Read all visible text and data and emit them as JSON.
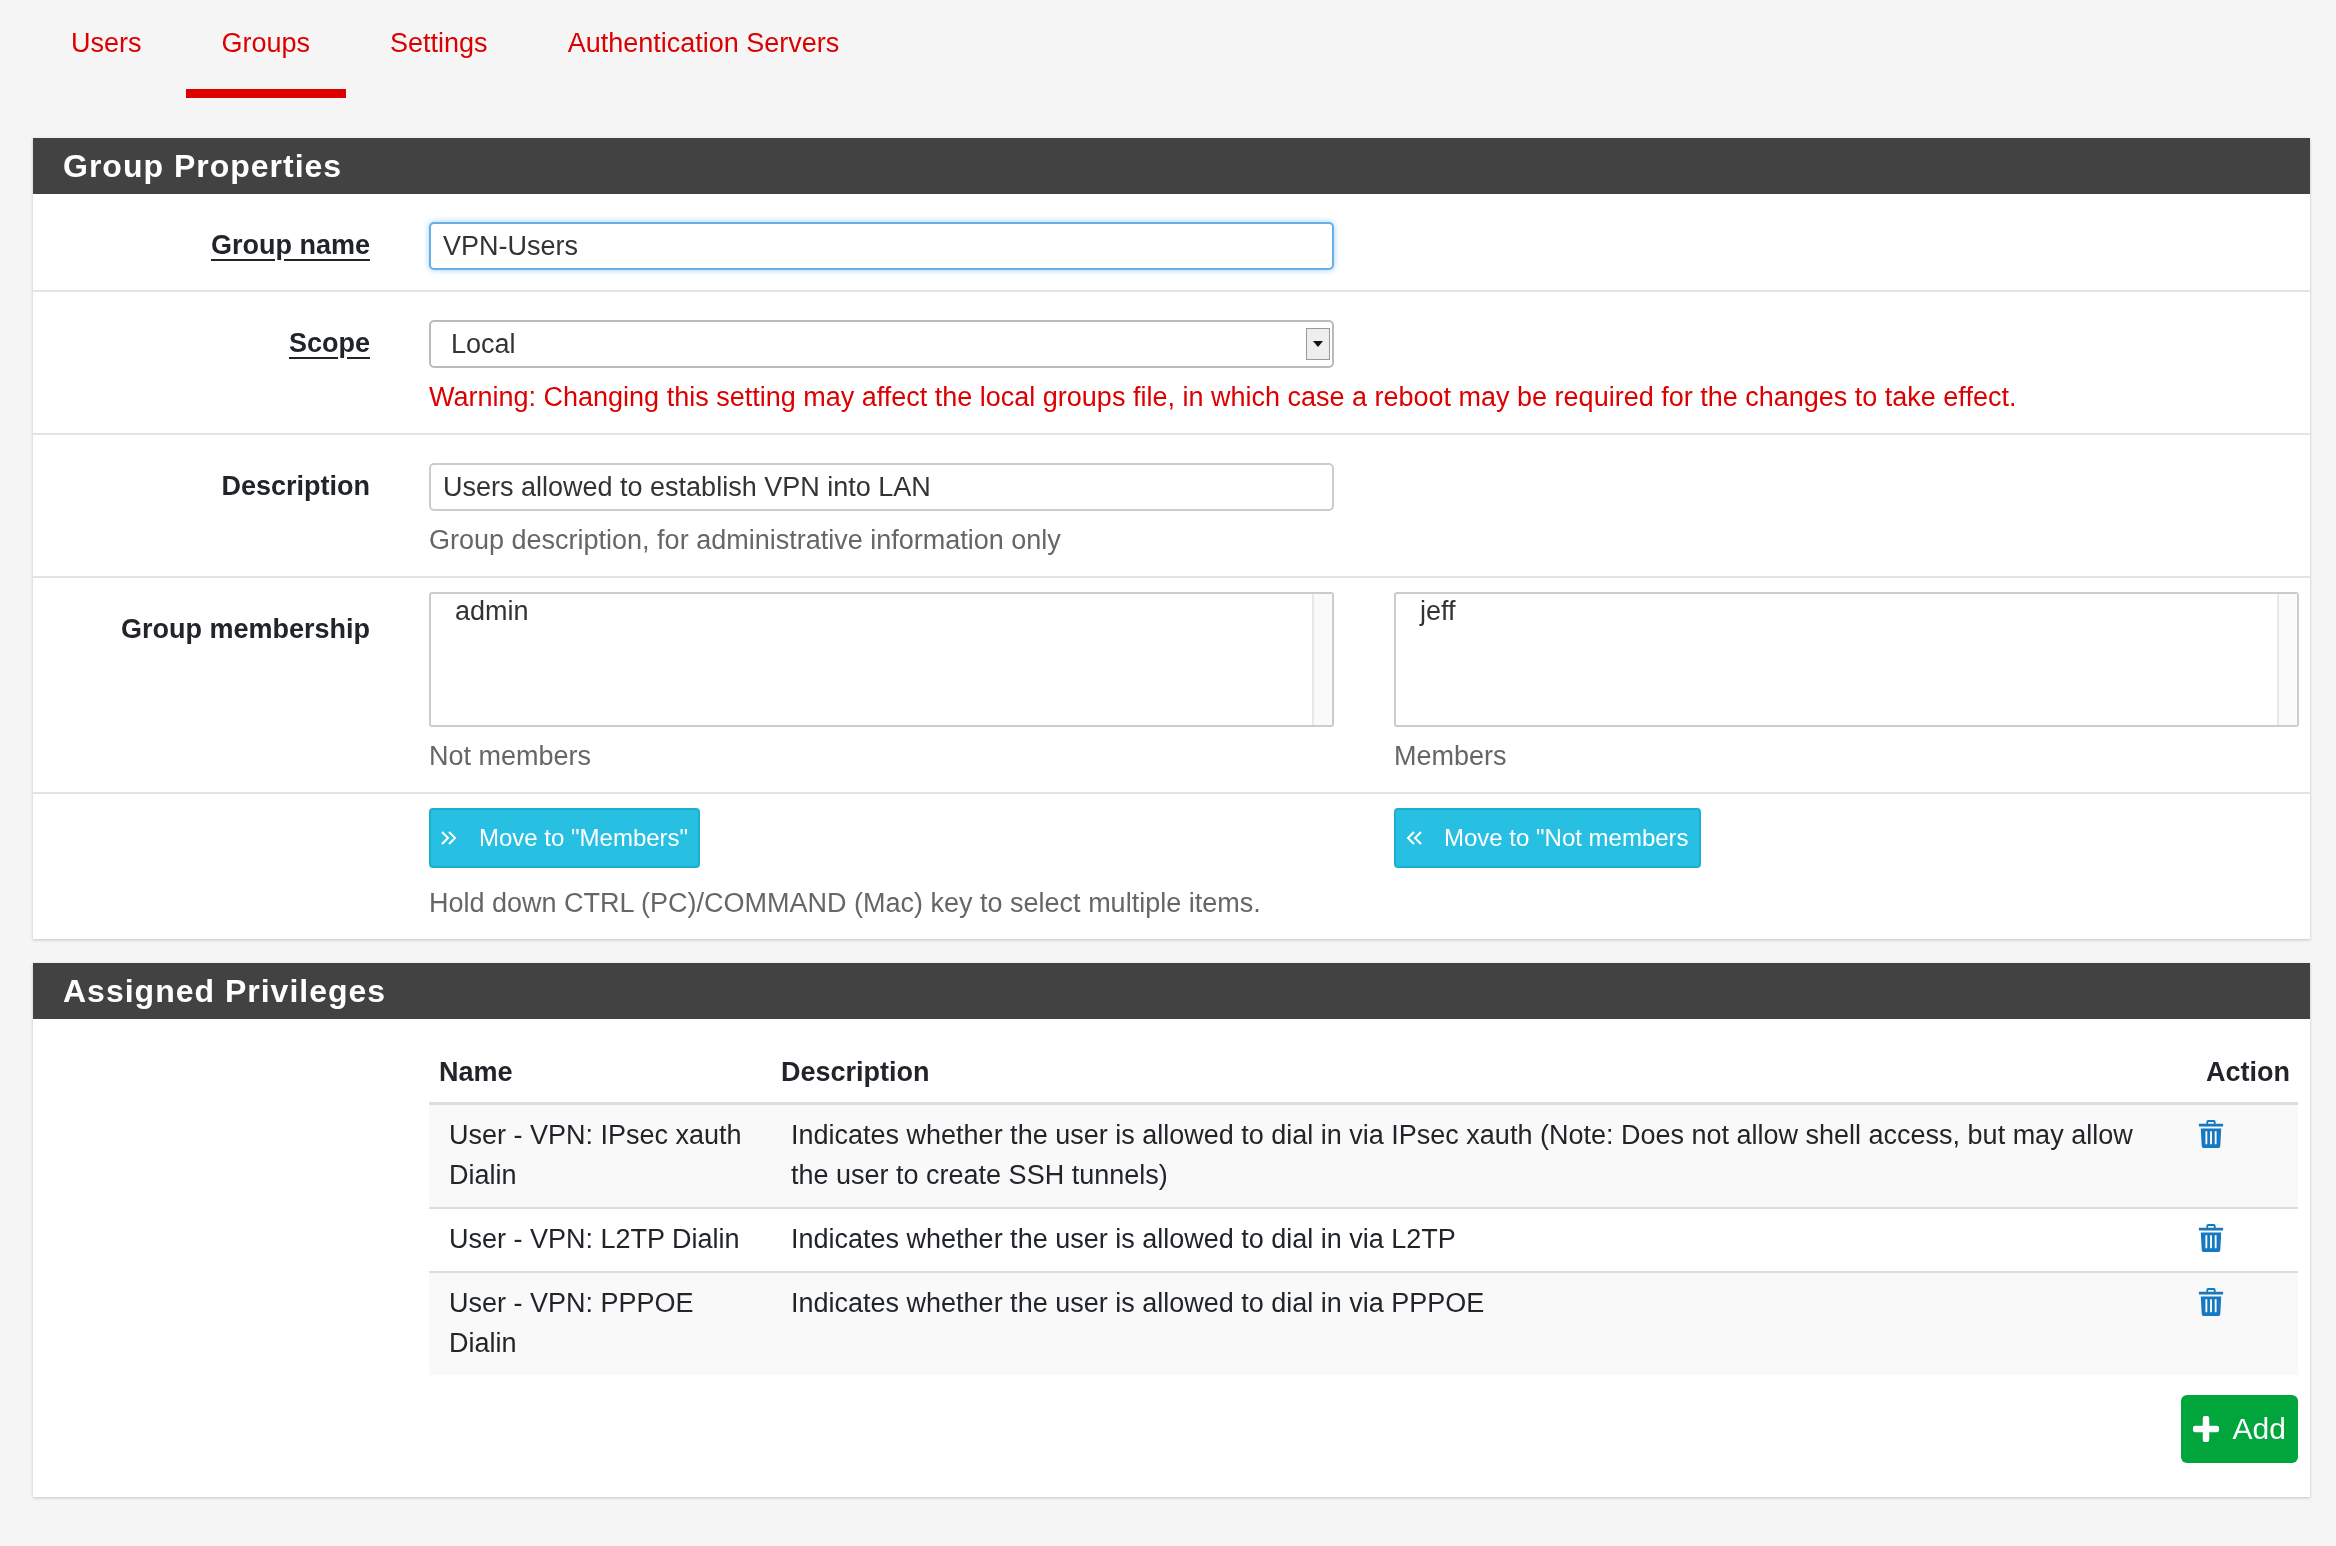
{
  "tabs": [
    {
      "label": "Users",
      "selected": false
    },
    {
      "label": "Groups",
      "selected": true
    },
    {
      "label": "Settings",
      "selected": false
    },
    {
      "label": "Authentication Servers",
      "selected": false
    }
  ],
  "group_properties": {
    "title": "Group Properties",
    "group_name": {
      "label": "Group name",
      "required": true,
      "value": "VPN-Users"
    },
    "scope": {
      "label": "Scope",
      "required": true,
      "value": "Local",
      "warning": "Warning: Changing this setting may affect the local groups file, in which case a reboot may be required for the changes to take effect."
    },
    "description": {
      "label": "Description",
      "required": false,
      "value": "Users allowed to establish VPN into LAN",
      "help": "Group description, for administrative information only"
    },
    "group_membership": {
      "label": "Group membership",
      "required": false,
      "lists": [
        {
          "items": [
            "admin"
          ],
          "caption": "Not members"
        },
        {
          "items": [
            "jeff"
          ],
          "caption": "Members"
        }
      ],
      "buttons": [
        {
          "kind": "forward",
          "label": "Move to \"Members\""
        },
        {
          "kind": "back",
          "label": "Move to \"Not members"
        }
      ],
      "help": "Hold down CTRL (PC)/COMMAND (Mac) key to select multiple items."
    }
  },
  "assigned_privileges": {
    "title": "Assigned Privileges",
    "columns": [
      "Name",
      "Description",
      "Action"
    ],
    "rows": [
      {
        "name": "User - VPN: IPsec xauth Dialin",
        "description": "Indicates whether the user is allowed to dial in via IPsec xauth (Note: Does not allow shell access, but may allow the user to create SSH tunnels)"
      },
      {
        "name": "User - VPN: L2TP Dialin",
        "description": "Indicates whether the user is allowed to dial in via L2TP"
      },
      {
        "name": "User - VPN: PPPOE Dialin",
        "description": "Indicates whether the user is allowed to dial in via PPPOE"
      }
    ],
    "add_button": "Add"
  }
}
